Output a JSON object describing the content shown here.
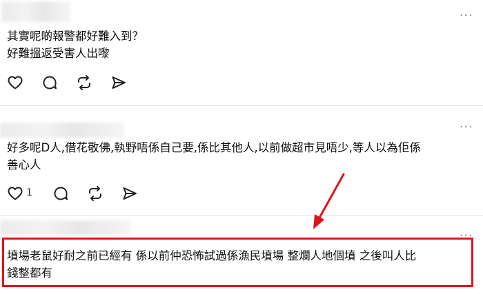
{
  "posts": [
    {
      "text_lines": [
        "其實呢啲報警都好難入到？",
        "好難搵返受害人出嚟"
      ],
      "like_count": ""
    },
    {
      "text_lines": [
        "好多呢D人,借花敬佛,執野唔係自己要,係比其他人,以前做超市見唔少,等人以為佢係",
        "善心人"
      ],
      "like_count": "1"
    },
    {
      "text_lines": [
        "墳場老鼠好耐之前已經有 係以前仲恐怖試過係漁民墳場 整爛人地個墳 之後叫人比",
        "錢整都有"
      ],
      "like_count": ""
    }
  ],
  "icons": {
    "more": "more-dots-icon",
    "like": "heart-icon",
    "reply": "comment-icon",
    "repost": "repost-icon",
    "share": "send-icon"
  },
  "annotation_colors": {
    "highlight": "#e0121b"
  },
  "more_glyph": "···"
}
